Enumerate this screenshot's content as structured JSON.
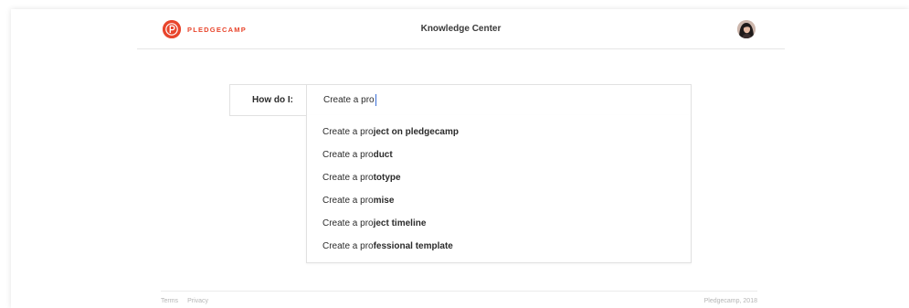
{
  "brand": {
    "name": "PLEDGECAMP",
    "accent_color": "#e8452c",
    "logo_icon": "pledgecamp-logo-icon"
  },
  "header": {
    "title": "Knowledge Center",
    "avatar_icon": "user-avatar"
  },
  "search": {
    "label": "How do I:",
    "value": "Create a pro",
    "suggestions": [
      {
        "prefix": "Create a pro",
        "completion": "ject on pledgecamp"
      },
      {
        "prefix": "Create a pro",
        "completion": "duct"
      },
      {
        "prefix": "Create a pro",
        "completion": "totype"
      },
      {
        "prefix": "Create a pro",
        "completion": "mise"
      },
      {
        "prefix": "Create a pro",
        "completion": "ject timeline"
      },
      {
        "prefix": "Create a pro",
        "completion": "fessional template"
      }
    ]
  },
  "footer": {
    "links": [
      "Terms",
      "Privacy"
    ],
    "copyright": "Pledgecamp, 2018"
  }
}
